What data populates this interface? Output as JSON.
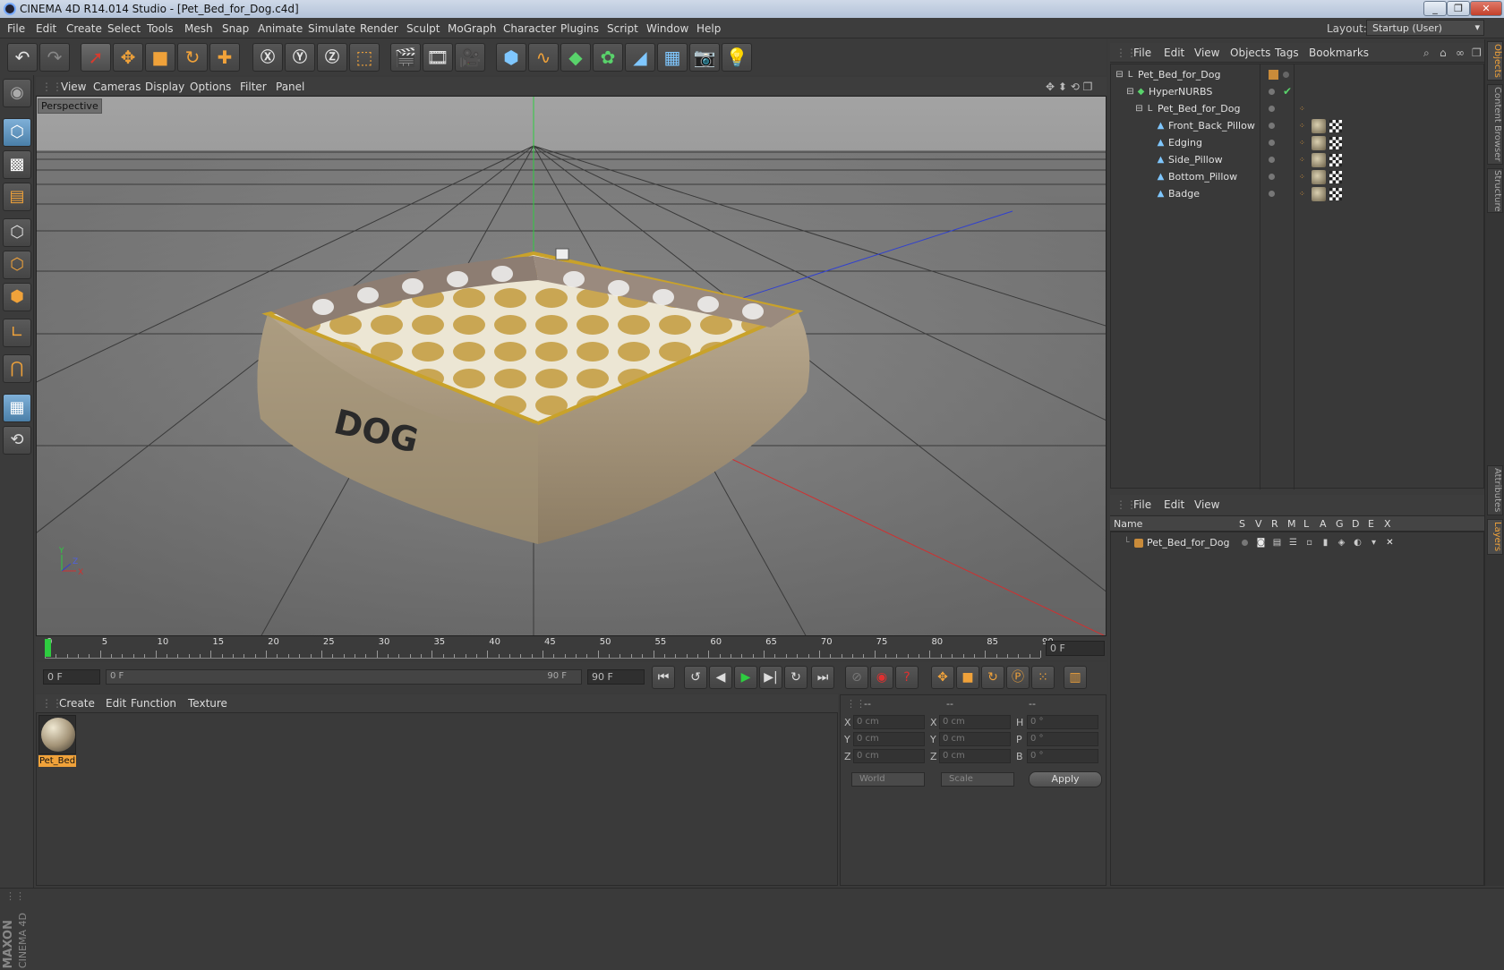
{
  "window": {
    "title": "CINEMA 4D R14.014 Studio - [Pet_Bed_for_Dog.c4d]",
    "controls": [
      "_",
      "❐",
      "✕"
    ]
  },
  "menubar": [
    "File",
    "Edit",
    "Create",
    "Select",
    "Tools",
    "Mesh",
    "Snap",
    "Animate",
    "Simulate",
    "Render",
    "Sculpt",
    "MoGraph",
    "Character",
    "Plugins",
    "Script",
    "Window",
    "Help"
  ],
  "layout": {
    "label": "Layout:",
    "value": "Startup (User)"
  },
  "viewport": {
    "menu": [
      "View",
      "Cameras",
      "Display",
      "Options",
      "Filter",
      "Panel"
    ],
    "label": "Perspective",
    "axis": {
      "y": "Y",
      "z": "Z",
      "x": "X"
    }
  },
  "timeline": {
    "ticks": [
      "0",
      "5",
      "10",
      "15",
      "20",
      "25",
      "30",
      "35",
      "40",
      "45",
      "50",
      "55",
      "60",
      "65",
      "70",
      "75",
      "80",
      "85",
      "90"
    ],
    "frame_field": "0 F"
  },
  "transport": {
    "start": "0 F",
    "range_start": "0 F",
    "range_end": "90 F",
    "end": "90 F"
  },
  "material_manager": {
    "menu": [
      "Create",
      "Edit",
      "Function",
      "Texture"
    ],
    "materials": [
      {
        "name": "Pet_Bed"
      }
    ]
  },
  "coordinates": {
    "headers": [
      "--",
      "--",
      "--"
    ],
    "rows": [
      {
        "a": "X",
        "av": "0 cm",
        "b": "X",
        "bv": "0 cm",
        "c": "H",
        "cv": "0 °"
      },
      {
        "a": "Y",
        "av": "0 cm",
        "b": "Y",
        "bv": "0 cm",
        "c": "P",
        "cv": "0 °"
      },
      {
        "a": "Z",
        "av": "0 cm",
        "b": "Z",
        "bv": "0 cm",
        "c": "B",
        "cv": "0 °"
      }
    ],
    "mode": "World",
    "size_mode": "Scale",
    "apply": "Apply"
  },
  "object_manager": {
    "menu": [
      "File",
      "Edit",
      "View",
      "Objects",
      "Tags",
      "Bookmarks"
    ],
    "objects": [
      {
        "name": "Pet_Bed_for_Dog",
        "type": "null"
      },
      {
        "name": "HyperNURBS",
        "type": "nurbs"
      },
      {
        "name": "Pet_Bed_for_Dog",
        "type": "null"
      },
      {
        "name": "Front_Back_Pillow",
        "type": "poly"
      },
      {
        "name": "Edging",
        "type": "poly"
      },
      {
        "name": "Side_Pillow",
        "type": "poly"
      },
      {
        "name": "Bottom_Pillow",
        "type": "poly"
      },
      {
        "name": "Badge",
        "type": "poly"
      }
    ]
  },
  "layer_manager": {
    "menu": [
      "File",
      "Edit",
      "View"
    ],
    "columns": [
      "Name",
      "S",
      "V",
      "R",
      "M",
      "L",
      "A",
      "G",
      "D",
      "E",
      "X"
    ],
    "layers": [
      {
        "name": "Pet_Bed_for_Dog",
        "color": "#c98b3a"
      }
    ]
  },
  "side_tabs": [
    "Objects",
    "Content Browser",
    "Structure",
    "Attributes",
    "Layers"
  ],
  "brand": {
    "maxon": "MAXON",
    "product": "CINEMA 4D"
  },
  "colors": {
    "accent": "#f0a23a",
    "active_blue": "#5a8fc0",
    "y_axis": "#2ecc40",
    "x_axis": "#d03030",
    "z_axis": "#3040d0"
  }
}
